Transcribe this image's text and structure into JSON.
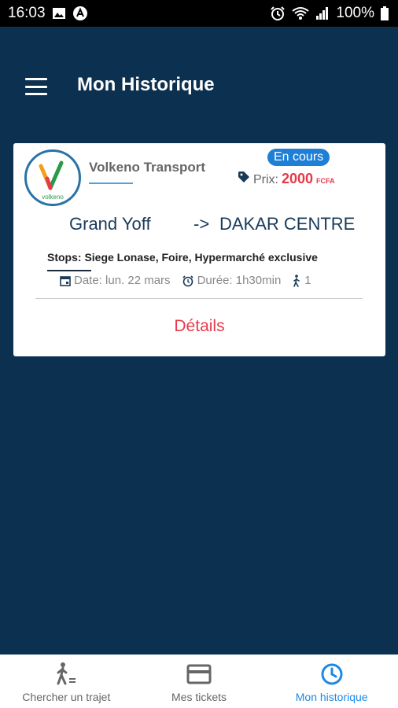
{
  "status_bar": {
    "time": "16:03",
    "battery": "100%"
  },
  "header": {
    "title": "Mon Historique"
  },
  "card": {
    "company": "Volkeno Transport",
    "logo_text": "volkeno",
    "status": "En cours",
    "price_label": "Prix:",
    "price_value": "2000",
    "price_currency": "FCFA",
    "from": "Grand Yoff",
    "arrow": "->",
    "to": "DAKAR CENTRE",
    "stops": "Stops: Siege Lonase, Foire, Hypermarché exclusive",
    "date": "Date: lun. 22 mars",
    "duration": "Durée: 1h30min",
    "passengers": "1",
    "details_label": "Détails"
  },
  "bottom_nav": {
    "items": [
      {
        "label": "Chercher un trajet",
        "icon": "walk-search-icon"
      },
      {
        "label": "Mes tickets",
        "icon": "card-icon"
      },
      {
        "label": "Mon historique",
        "icon": "clock-icon"
      }
    ],
    "active_index": 2
  },
  "colors": {
    "background": "#0c3050",
    "accent_red": "#e8394a",
    "accent_blue": "#1e88e5"
  }
}
